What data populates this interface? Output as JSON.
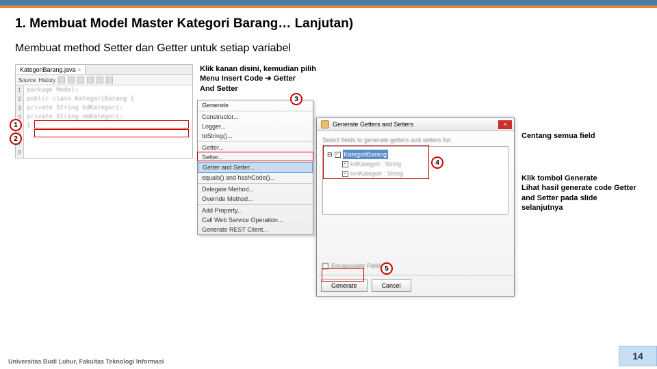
{
  "heading": "1.   Membuat Model Master Kategori Barang… Lanjutan)",
  "subheading": "Membuat method Setter dan Getter untuk setiap variabel",
  "editor": {
    "tab": "KategoriBarang.java",
    "sub_source": "Source",
    "sub_history": "History",
    "gutter": [
      "1",
      "2",
      "3",
      "4",
      "5",
      "6",
      "7",
      "8"
    ],
    "lines": [
      {
        "text": "package Model;"
      },
      {
        "text": ""
      },
      {
        "text": "public class KategoriBarang {"
      },
      {
        "text": "    private String kdKategori;"
      },
      {
        "text": "    private String nmKategori;"
      },
      {
        "text": ""
      },
      {
        "text": "}"
      },
      {
        "text": ""
      }
    ]
  },
  "note1_l1": "Klik kanan disini, kemudian pilih",
  "note1_l2_a": "Menu Insert Code ",
  "note1_l2_b": " Getter",
  "note1_l3": "And Setter",
  "ctxmenu": {
    "header": "Generate",
    "items": [
      "Constructor...",
      "Logger...",
      "toString()...",
      "Getter...",
      "Setter...",
      "Getter and Setter...",
      "equals() and hashCode()...",
      "Delegate Method...",
      "Override Method...",
      "Add Property...",
      "Call Web Service Operation...",
      "Generate REST Client..."
    ]
  },
  "dialog": {
    "title": "Generate Getters and Setters",
    "label": "Select fields to generate getters and setters for:",
    "root": "KategoriBarang",
    "fields": [
      "kdKategori : String",
      "nmKategori : String"
    ],
    "encap_label": "Encapsulate Fields",
    "btn_gen": "Generate",
    "btn_cancel": "Cancel"
  },
  "note2": "Centang semua field",
  "note3_l1": "Klik tombol Generate",
  "note3_l2": "Lihat hasil generate code Getter",
  "note3_l3": "and Setter pada slide",
  "note3_l4": "selanjutnya",
  "footer": "Universitas Budi Luhur, Fakultas Teknologi Informasi",
  "page": "14",
  "badges": {
    "b1": "1",
    "b2": "2",
    "b3": "3",
    "b4": "4",
    "b5": "5"
  }
}
